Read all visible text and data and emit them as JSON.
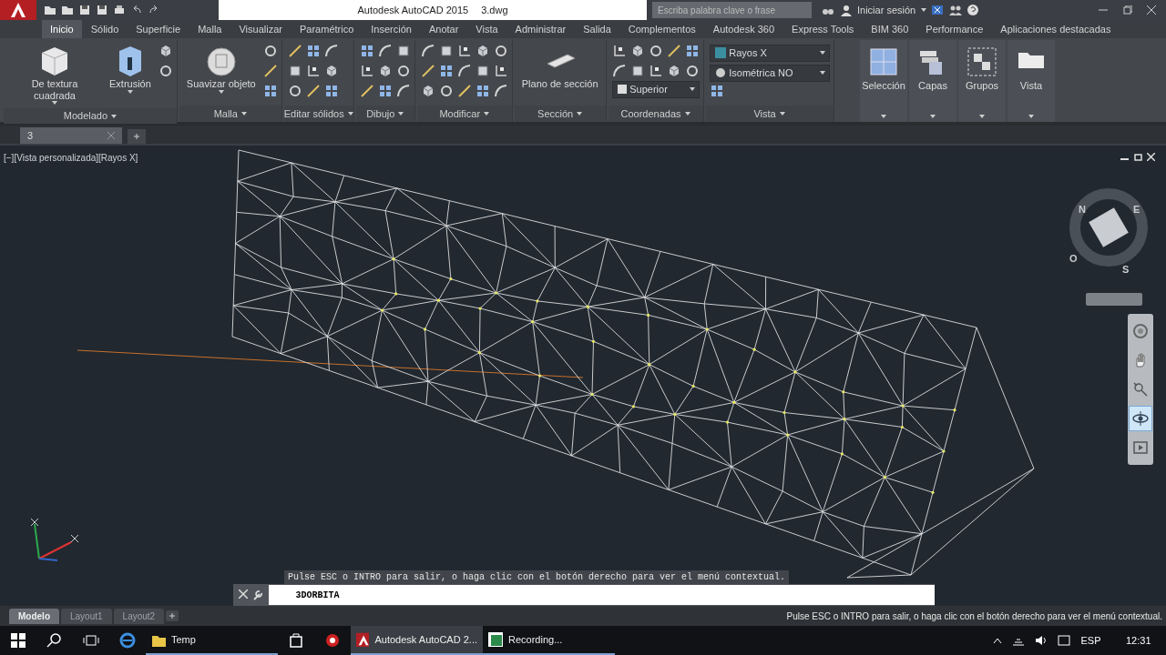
{
  "title_bar": {
    "title": "Autodesk AutoCAD 2015",
    "file": "3.dwg",
    "search": {
      "placeholder": "Escriba palabra clave o frase"
    },
    "sign_in": "Iniciar sesión"
  },
  "ribbon_tabs": [
    {
      "label": "Inicio",
      "selected": true
    },
    {
      "label": "Sólido",
      "selected": false
    },
    {
      "label": "Superficie",
      "selected": false
    },
    {
      "label": "Malla",
      "selected": false
    },
    {
      "label": "Visualizar",
      "selected": false
    },
    {
      "label": "Paramétrico",
      "selected": false
    },
    {
      "label": "Inserción",
      "selected": false
    },
    {
      "label": "Anotar",
      "selected": false
    },
    {
      "label": "Vista",
      "selected": false
    },
    {
      "label": "Administrar",
      "selected": false
    },
    {
      "label": "Salida",
      "selected": false
    },
    {
      "label": "Complementos",
      "selected": false
    },
    {
      "label": "Autodesk 360",
      "selected": false
    },
    {
      "label": "Express Tools",
      "selected": false
    },
    {
      "label": "BIM 360",
      "selected": false
    },
    {
      "label": "Performance",
      "selected": false
    },
    {
      "label": "Aplicaciones destacadas",
      "selected": false
    }
  ],
  "ribbon_panels": [
    {
      "kind": "tools",
      "title": "Modelado",
      "large_buttons": [
        "De textura cuadrada",
        "Extrusión"
      ]
    },
    {
      "kind": "tools",
      "title": "Malla",
      "large_buttons": [
        "Suavizar objeto"
      ]
    },
    {
      "kind": "tools",
      "title": "Editar sólidos"
    },
    {
      "kind": "tools",
      "title": "Dibujo"
    },
    {
      "kind": "tools",
      "title": "Modificar"
    },
    {
      "kind": "tools",
      "title": "Sección",
      "large_buttons": [
        "Plano de sección"
      ]
    },
    {
      "kind": "tools",
      "title": "Coordenadas",
      "dropdowns": [
        "Superior"
      ]
    },
    {
      "kind": "tools",
      "title": "Vista",
      "dropdowns": [
        "Rayos X",
        "Isométrica NO"
      ]
    },
    {
      "kind": "flyout",
      "label": "Selección"
    },
    {
      "kind": "flyout",
      "label": "Capas"
    },
    {
      "kind": "flyout",
      "label": "Grupos"
    },
    {
      "kind": "flyout",
      "label": "Vista"
    }
  ],
  "file_tabs": [
    {
      "label": "3",
      "selected": true
    }
  ],
  "viewport": {
    "label": "[−][Vista personalizada][Rayos X]",
    "compass": [
      "N",
      "E",
      "S",
      "O"
    ]
  },
  "nav_bar": {
    "tools": [
      {
        "kind": "wheel",
        "selected": false
      },
      {
        "kind": "pan",
        "selected": false
      },
      {
        "kind": "zoom",
        "selected": false
      },
      {
        "kind": "orbit",
        "selected": true
      },
      {
        "kind": "showmotion",
        "selected": false
      }
    ]
  },
  "command_line": {
    "history": "Pulse ESC o INTRO para salir, o haga clic con el botón derecho para ver el menú contextual.",
    "value": "3DORBITA"
  },
  "layout_tabs": [
    {
      "label": "Modelo",
      "selected": true
    },
    {
      "label": "Layout1",
      "selected": false
    },
    {
      "label": "Layout2",
      "selected": false
    }
  ],
  "status_text": "Pulse ESC o INTRO para salir, o haga clic con el botón derecho para ver el menú contextual.",
  "taskbar": {
    "apps": [
      {
        "label": "Temp",
        "kind": "folder",
        "selected": false
      },
      {
        "label": "Autodesk AutoCAD 2...",
        "kind": "autocad",
        "selected": true
      },
      {
        "label": "Recording...",
        "kind": "recorder",
        "selected": false
      }
    ],
    "language": "ESP",
    "time": "12:31"
  }
}
